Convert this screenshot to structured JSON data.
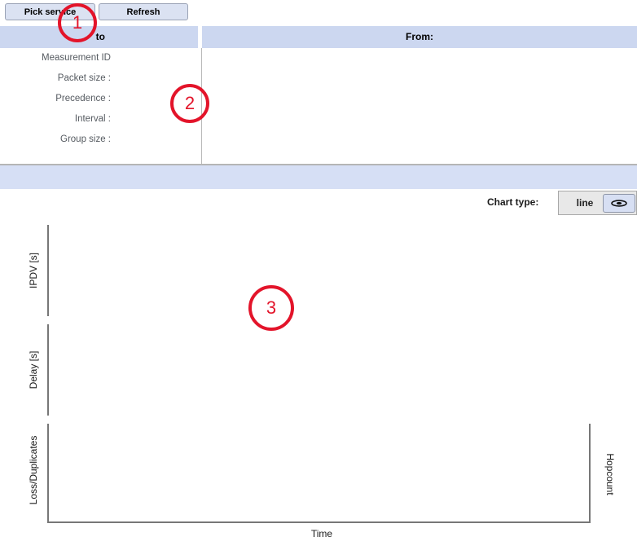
{
  "toolbar": {
    "pick_service_label": "Pick service",
    "refresh_label": "Refresh"
  },
  "header": {
    "left_label": "to",
    "right_label": "From:"
  },
  "form": {
    "labels": [
      "Measurement ID",
      "Packet size :",
      "Precedence :",
      "Interval :",
      "Group size :"
    ]
  },
  "chart_type": {
    "label": "Chart type:",
    "selected": "line",
    "dropdown_icon": "lens-diamond-icon",
    "options": [
      "line"
    ]
  },
  "chart_data": {
    "type": "line",
    "title": "",
    "xlabel": "Time",
    "x": [],
    "series": [],
    "panels": [
      {
        "ylabel": "IPDV [s]",
        "values": []
      },
      {
        "ylabel": "Delay [s]",
        "values": []
      },
      {
        "ylabel": "Loss/Duplicates",
        "values": []
      }
    ],
    "secondary_ylabel": "Hopcount",
    "grid": false,
    "legend": "none",
    "empty": true
  },
  "annotations": {
    "color": "#e3142a",
    "markers": [
      {
        "label": "1"
      },
      {
        "label": "2"
      },
      {
        "label": "3"
      }
    ]
  }
}
